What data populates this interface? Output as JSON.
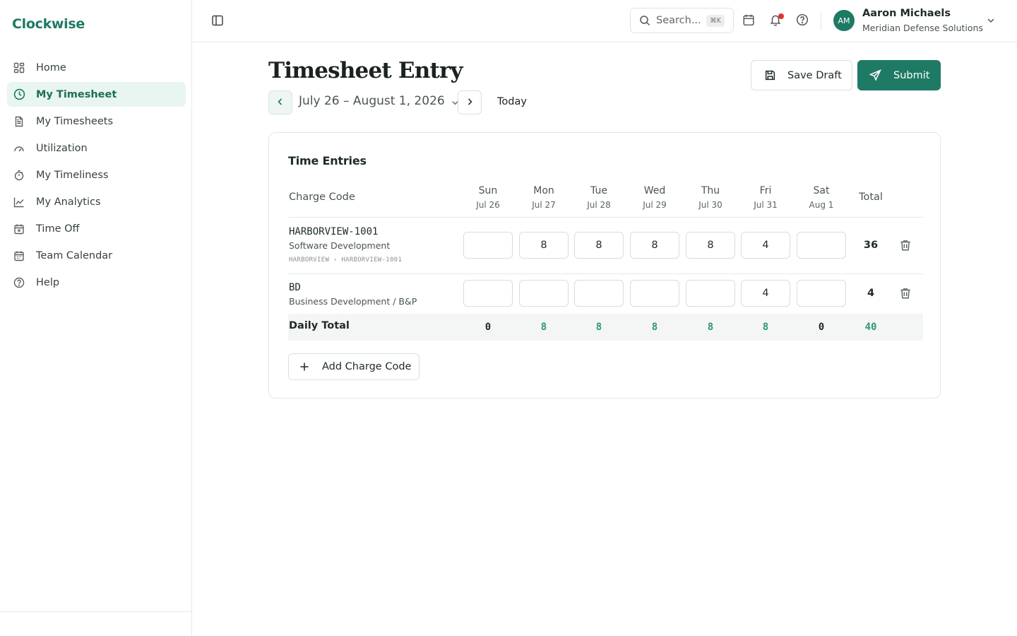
{
  "brand": "Clockwise",
  "nav": [
    {
      "label": "Home",
      "icon": "grid-icon"
    },
    {
      "label": "My Timesheet",
      "icon": "clock-icon",
      "active": true
    },
    {
      "label": "My Timesheets",
      "icon": "document-icon"
    },
    {
      "label": "Utilization",
      "icon": "gauge-icon"
    },
    {
      "label": "My Timeliness",
      "icon": "stopwatch-icon"
    },
    {
      "label": "My Analytics",
      "icon": "line-chart-icon"
    },
    {
      "label": "Time Off",
      "icon": "calendar-x-icon"
    },
    {
      "label": "Team Calendar",
      "icon": "calendar-icon"
    },
    {
      "label": "Help",
      "icon": "help-circle-icon"
    }
  ],
  "header": {
    "search_placeholder": "Search...",
    "search_shortcut": "⌘K",
    "user_initials": "AM",
    "user_name": "Aaron Michaels",
    "user_org": "Meridian Defense Solutions"
  },
  "page": {
    "title": "Timesheet Entry",
    "date_range": "July 26 – August 1, 2026",
    "today_label": "Today",
    "save_label": "Save Draft",
    "submit_label": "Submit"
  },
  "card": {
    "title": "Time Entries",
    "col_code": "Charge Code",
    "col_total": "Total",
    "days": [
      {
        "day": "Sun",
        "date": "Jul 26"
      },
      {
        "day": "Mon",
        "date": "Jul 27"
      },
      {
        "day": "Tue",
        "date": "Jul 28"
      },
      {
        "day": "Wed",
        "date": "Jul 29"
      },
      {
        "day": "Thu",
        "date": "Jul 30"
      },
      {
        "day": "Fri",
        "date": "Jul 31"
      },
      {
        "day": "Sat",
        "date": "Aug 1"
      }
    ],
    "rows": [
      {
        "code": "HARBORVIEW-1001",
        "desc": "Software Development",
        "path": "HARBORVIEW › HARBORVIEW-1001",
        "hours": [
          "",
          "8",
          "8",
          "8",
          "8",
          "4",
          ""
        ],
        "total": "36"
      },
      {
        "code": "BD",
        "desc": "Business Development / B&P",
        "path": "",
        "hours": [
          "",
          "",
          "",
          "",
          "",
          "4",
          ""
        ],
        "total": "4"
      }
    ],
    "daily_label": "Daily Total",
    "daily_totals": [
      "0",
      "8",
      "8",
      "8",
      "8",
      "8",
      "0"
    ],
    "grand_total": "40",
    "add_label": "Add Charge Code"
  },
  "colors": {
    "accent": "#1e7a64",
    "accent_light": "#e8f5f0",
    "positive": "#2e9a6f",
    "notification": "#e0352b"
  }
}
